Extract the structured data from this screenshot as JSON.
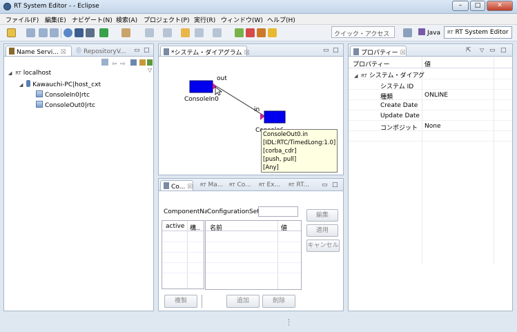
{
  "window": {
    "title": "RT System Editor - - Eclipse",
    "minimize": "–",
    "maximize": "□",
    "close": "✕"
  },
  "menu": [
    "ファイル(F)",
    "編集(E)",
    "ナビゲート(N)",
    "検索(A)",
    "プロジェクト(P)",
    "実行(R)",
    "ウィンドウ(W)",
    "ヘルプ(H)"
  ],
  "toolbar": {
    "quick_access": "クイック・アクセス",
    "perspectives": [
      {
        "label": "Java",
        "icon": "java-icon",
        "active": false
      },
      {
        "label": "RT System Editor",
        "prefix": "RT",
        "active": true
      }
    ]
  },
  "name_service": {
    "tabs": [
      {
        "label": "Name Servi...",
        "close": "☒"
      },
      {
        "label": "RepositoryV...",
        "close": ""
      }
    ],
    "tree": {
      "root": {
        "prefix": "RT",
        "label": "localhost"
      },
      "host": {
        "label": "Kawauchi-PC|host_cxt"
      },
      "children": [
        {
          "label": "ConsoleIn0|rtc"
        },
        {
          "label": "ConsoleOut0|rtc"
        }
      ]
    }
  },
  "diagram": {
    "tab": "*システム・ダイアグラム",
    "close": "☒",
    "component_in": {
      "label": "ConsoleIn0",
      "port": "out"
    },
    "component_out": {
      "label": "ConsoleOut0",
      "port": "in"
    },
    "tooltip": [
      "ConsoleOut0.in",
      "[IDL:RTC/TimedLong:1.0]",
      "[corba_cdr]",
      "[push, pull]",
      "[Any]"
    ]
  },
  "config": {
    "tabs": [
      {
        "label": "Co...",
        "active": true
      },
      {
        "label": "Ma..."
      },
      {
        "label": "Co..."
      },
      {
        "label": "Ex..."
      },
      {
        "label": "RT..."
      }
    ],
    "tab_prefix": "RT",
    "component_name_label": "ComponentNa",
    "configset_label": "ConfigurationSet:",
    "configset_value": "",
    "left_table_headers": [
      "active",
      "構.."
    ],
    "right_table_headers": [
      "名前",
      "値"
    ],
    "buttons": {
      "edit": "編集",
      "apply": "適用",
      "cancel": "キャンセル",
      "copy": "複製",
      "add": "追加",
      "delete": "削除"
    }
  },
  "properties": {
    "tab": "プロパティー",
    "headers": [
      "プロパティー",
      "値"
    ],
    "group": {
      "prefix": "RT",
      "label": "システム・ダイアグ"
    },
    "rows": [
      {
        "key": "システム ID",
        "value": ""
      },
      {
        "key": "種類",
        "value": "ONLINE"
      },
      {
        "key": "Create Date",
        "value": ""
      },
      {
        "key": "Update Date",
        "value": ""
      },
      {
        "key": "コンポジット",
        "value": "None"
      }
    ]
  },
  "colors": {
    "component_fill": "#0000ee",
    "port_fill": "#cc2299",
    "tooltip_bg": "#ffffe1"
  }
}
